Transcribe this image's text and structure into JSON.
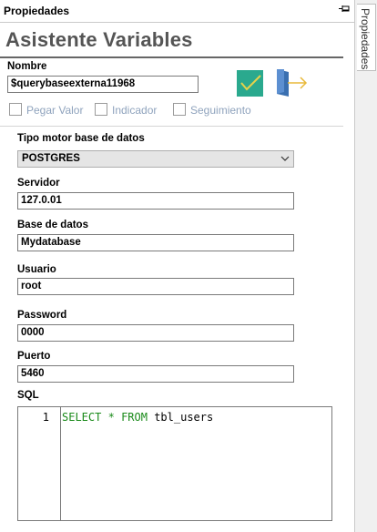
{
  "pane": {
    "title": "Propiedades",
    "side_tab": "Propiedades"
  },
  "header": {
    "title": "Asistente Variables"
  },
  "nombre": {
    "label": "Nombre",
    "value": "$querybaseexterna11968"
  },
  "checks": [
    {
      "label": "Pegar Valor",
      "checked": false
    },
    {
      "label": "Indicador",
      "checked": false
    },
    {
      "label": "Seguimiento",
      "checked": false
    }
  ],
  "engine": {
    "label": "Tipo motor base de datos",
    "value": "POSTGRES"
  },
  "server": {
    "label": "Servidor",
    "value": "127.0.01"
  },
  "database": {
    "label": "Base de datos",
    "value": "Mydatabase"
  },
  "user": {
    "label": "Usuario",
    "value": "root"
  },
  "password": {
    "label": "Password",
    "value": "0000"
  },
  "port": {
    "label": "Puerto",
    "value": "5460"
  },
  "sql": {
    "label": "SQL",
    "line_number": "1",
    "kw_select": "SELECT",
    "star": "*",
    "kw_from": "FROM",
    "table": "tbl_users"
  },
  "colors": {
    "accent_green": "#2aa98e",
    "door_blue": "#3a6fb0",
    "arrow_yellow": "#e8b93a"
  },
  "icons": {
    "confirm": "check-icon",
    "exit": "exit-door-icon",
    "pin": "pin-icon"
  }
}
